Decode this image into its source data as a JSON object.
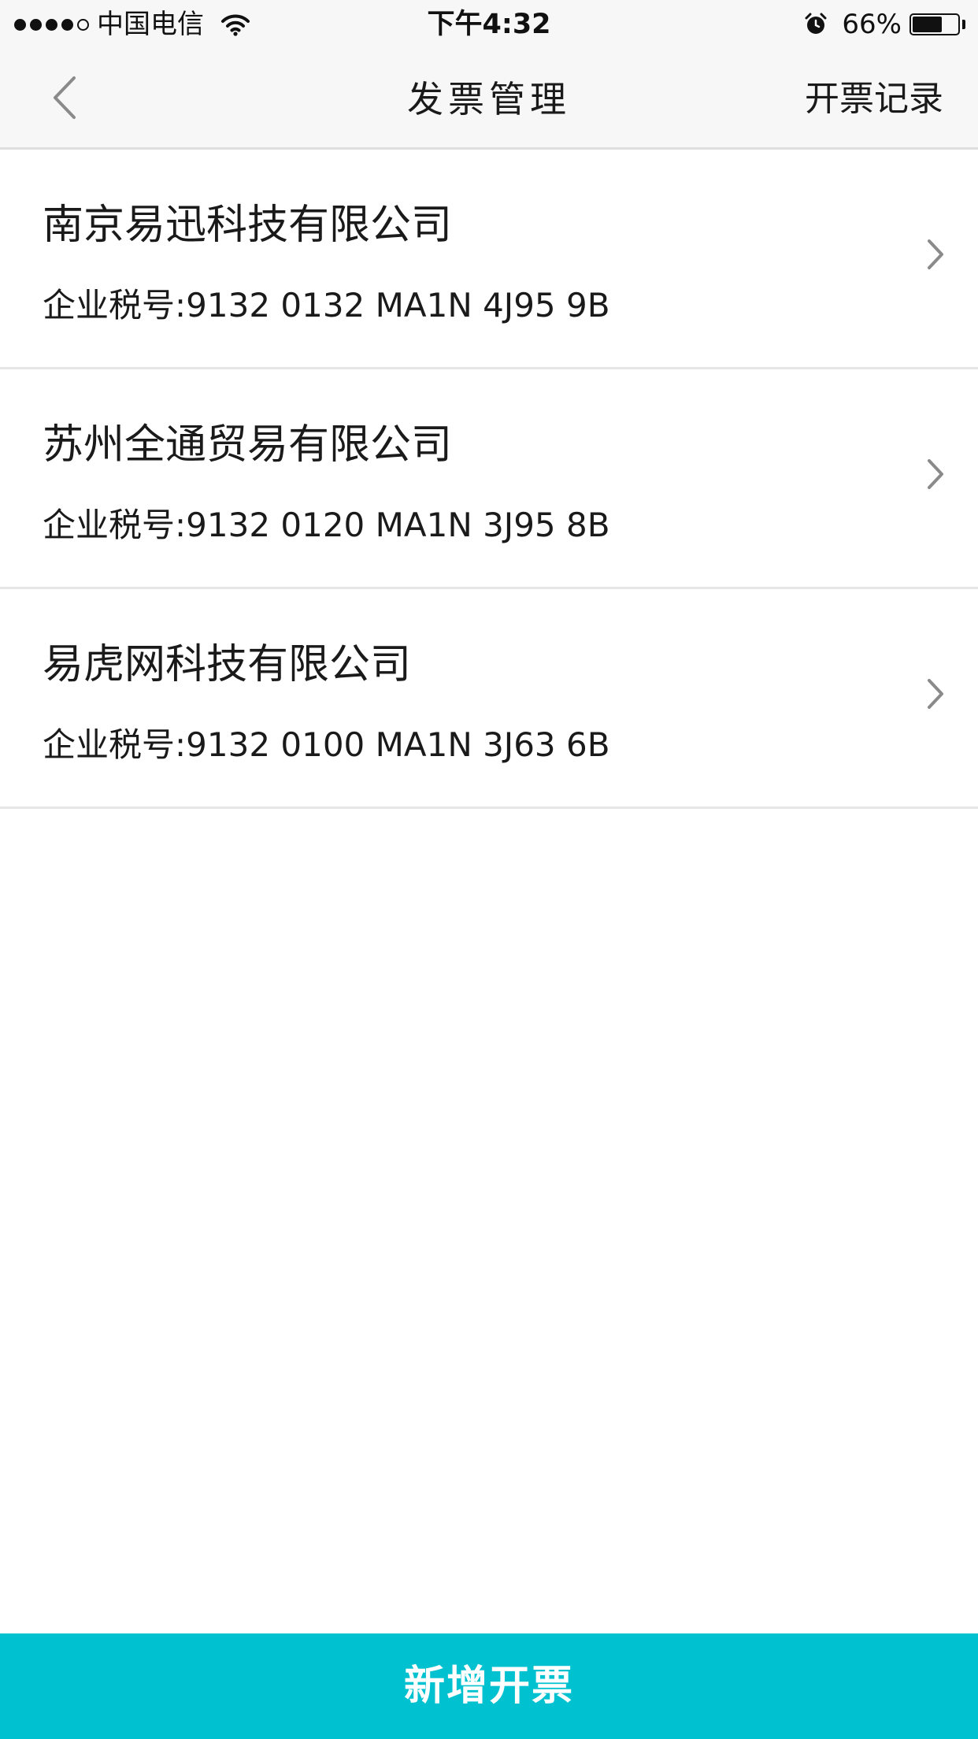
{
  "status_bar": {
    "carrier": "中国电信",
    "time": "下午4:32",
    "battery_percent": "66%",
    "battery_level": 0.66,
    "signal_bars_filled": 4,
    "signal_bars_total": 5,
    "icons": [
      "wifi-icon",
      "alarm-icon",
      "battery-icon"
    ]
  },
  "nav": {
    "title": "发票管理",
    "right_action": "开票记录",
    "back_icon": "chevron-left-icon"
  },
  "companies": [
    {
      "name": "南京易迅科技有限公司",
      "tax_label": "企业税号:",
      "tax_number": "9132 0132 MA1N 4J95 9B"
    },
    {
      "name": "苏州全通贸易有限公司",
      "tax_label": "企业税号:",
      "tax_number": "9132 0120 MA1N 3J95 8B"
    },
    {
      "name": "易虎网科技有限公司",
      "tax_label": "企业税号:",
      "tax_number": "9132 0100 MA1N 3J63 6B"
    }
  ],
  "footer": {
    "add_button_label": "新增开票"
  },
  "colors": {
    "accent": "#00c1d0",
    "bar_background": "#f7f7f7",
    "divider": "#e6e6e6",
    "chevron": "#8a8a8a"
  }
}
